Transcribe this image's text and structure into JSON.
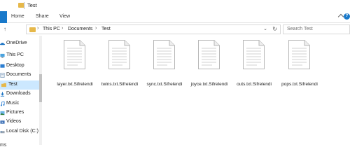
{
  "window": {
    "title": "Test"
  },
  "ribbon": {
    "tabs": [
      "Home",
      "Share",
      "View"
    ]
  },
  "address": {
    "crumbs": [
      "This PC",
      "Documents",
      "Test"
    ],
    "search_placeholder": "Search Test"
  },
  "nav": {
    "items": [
      {
        "label": "OneDrive",
        "icon": "cloud-icon"
      },
      {
        "label": "This PC",
        "icon": "pc-icon"
      },
      {
        "label": "Desktop",
        "icon": "desktop-icon"
      },
      {
        "label": "Documents",
        "icon": "documents-icon"
      },
      {
        "label": "Test",
        "icon": "folder-icon",
        "selected": true
      },
      {
        "label": "Downloads",
        "icon": "download-icon"
      },
      {
        "label": "Music",
        "icon": "music-icon"
      },
      {
        "label": "Pictures",
        "icon": "pictures-icon"
      },
      {
        "label": "Videos",
        "icon": "videos-icon"
      },
      {
        "label": "Local Disk (C:)",
        "icon": "disk-icon"
      }
    ]
  },
  "files": [
    {
      "name": "layer.txt.Sifrelendi"
    },
    {
      "name": "twins.txt.Sifrelendi"
    },
    {
      "name": "sync.txt.Sifrelendi"
    },
    {
      "name": "joyce.txt.Sifrelendi"
    },
    {
      "name": "outs.txt.Sifrelendi"
    },
    {
      "name": "pops.txt.Sifrelendi"
    }
  ],
  "status": {
    "text": "ms"
  },
  "colors": {
    "accent": "#1979ca",
    "folder": "#e6b84a",
    "selected": "#cce8ff"
  }
}
